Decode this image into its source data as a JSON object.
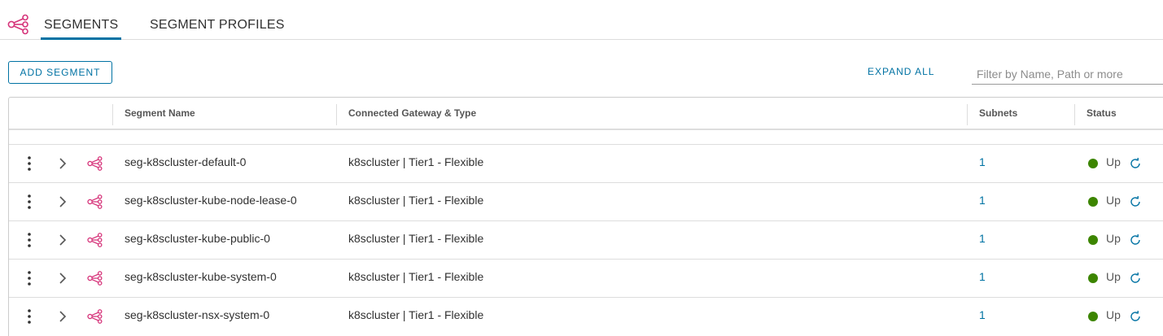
{
  "tabs": {
    "logo_icon": "segments-icon",
    "items": [
      {
        "label": "SEGMENTS",
        "active": true
      },
      {
        "label": "SEGMENT PROFILES",
        "active": false
      }
    ]
  },
  "toolbar": {
    "add_label": "ADD SEGMENT",
    "expand_label": "EXPAND ALL",
    "filter_placeholder": "Filter by Name, Path or more",
    "filter_value": ""
  },
  "grid": {
    "columns": {
      "name": "Segment Name",
      "gateway": "Connected Gateway & Type",
      "subnets": "Subnets",
      "status": "Status"
    },
    "rows": [
      {
        "name": "seg-k8scluster-default-0",
        "gateway": "k8scluster | Tier1 - Flexible",
        "subnets": "1",
        "status": "Up"
      },
      {
        "name": "seg-k8scluster-kube-node-lease-0",
        "gateway": "k8scluster | Tier1 - Flexible",
        "subnets": "1",
        "status": "Up"
      },
      {
        "name": "seg-k8scluster-kube-public-0",
        "gateway": "k8scluster | Tier1 - Flexible",
        "subnets": "1",
        "status": "Up"
      },
      {
        "name": "seg-k8scluster-kube-system-0",
        "gateway": "k8scluster | Tier1 - Flexible",
        "subnets": "1",
        "status": "Up"
      },
      {
        "name": "seg-k8scluster-nsx-system-0",
        "gateway": "k8scluster | Tier1 - Flexible",
        "subnets": "1",
        "status": "Up"
      }
    ]
  },
  "colors": {
    "accent": "#0072a3",
    "segment_icon": "#d6347a",
    "status_up": "#3c8500"
  }
}
